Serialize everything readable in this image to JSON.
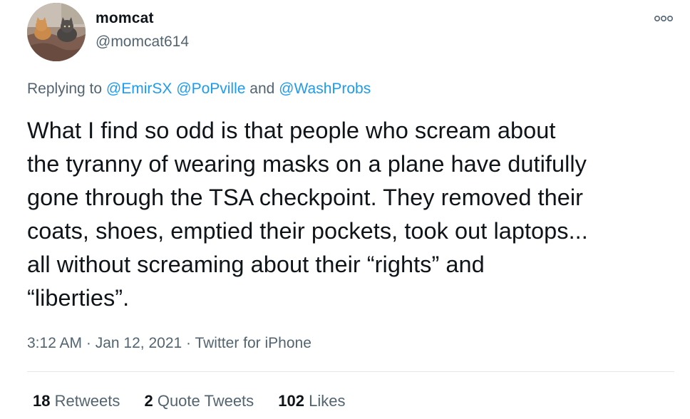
{
  "author": {
    "display_name": "momcat",
    "handle": "@momcat614",
    "avatar_icon": "avatar-cats-photo"
  },
  "more_icon": "more-options-icon",
  "reply": {
    "prefix": "Replying to ",
    "mention_1": "@EmirSX",
    "space": " ",
    "mention_2": "@PoPville",
    "joiner": " and ",
    "mention_3": "@WashProbs"
  },
  "tweet": {
    "lines": [
      "What I find so odd is that people who scream about",
      "the tyranny of wearing masks on a plane have dutifully",
      "gone through the TSA checkpoint. They removed their",
      "coats, shoes, emptied their pockets, took out laptops...",
      "all without screaming about their “rights” and",
      "“liberties”."
    ]
  },
  "meta": {
    "time": "3:12 AM",
    "sep_1": " · ",
    "date": "Jan 12, 2021",
    "sep_2": " · ",
    "source": "Twitter for iPhone"
  },
  "stats": {
    "retweets_count": "18",
    "retweets_label": "Retweets",
    "quotes_count": "2",
    "quotes_label": "Quote Tweets",
    "likes_count": "102",
    "likes_label": "Likes"
  },
  "colors": {
    "link": "#1d9bf0",
    "secondary_text": "#536471",
    "primary_text": "#0f1419"
  }
}
